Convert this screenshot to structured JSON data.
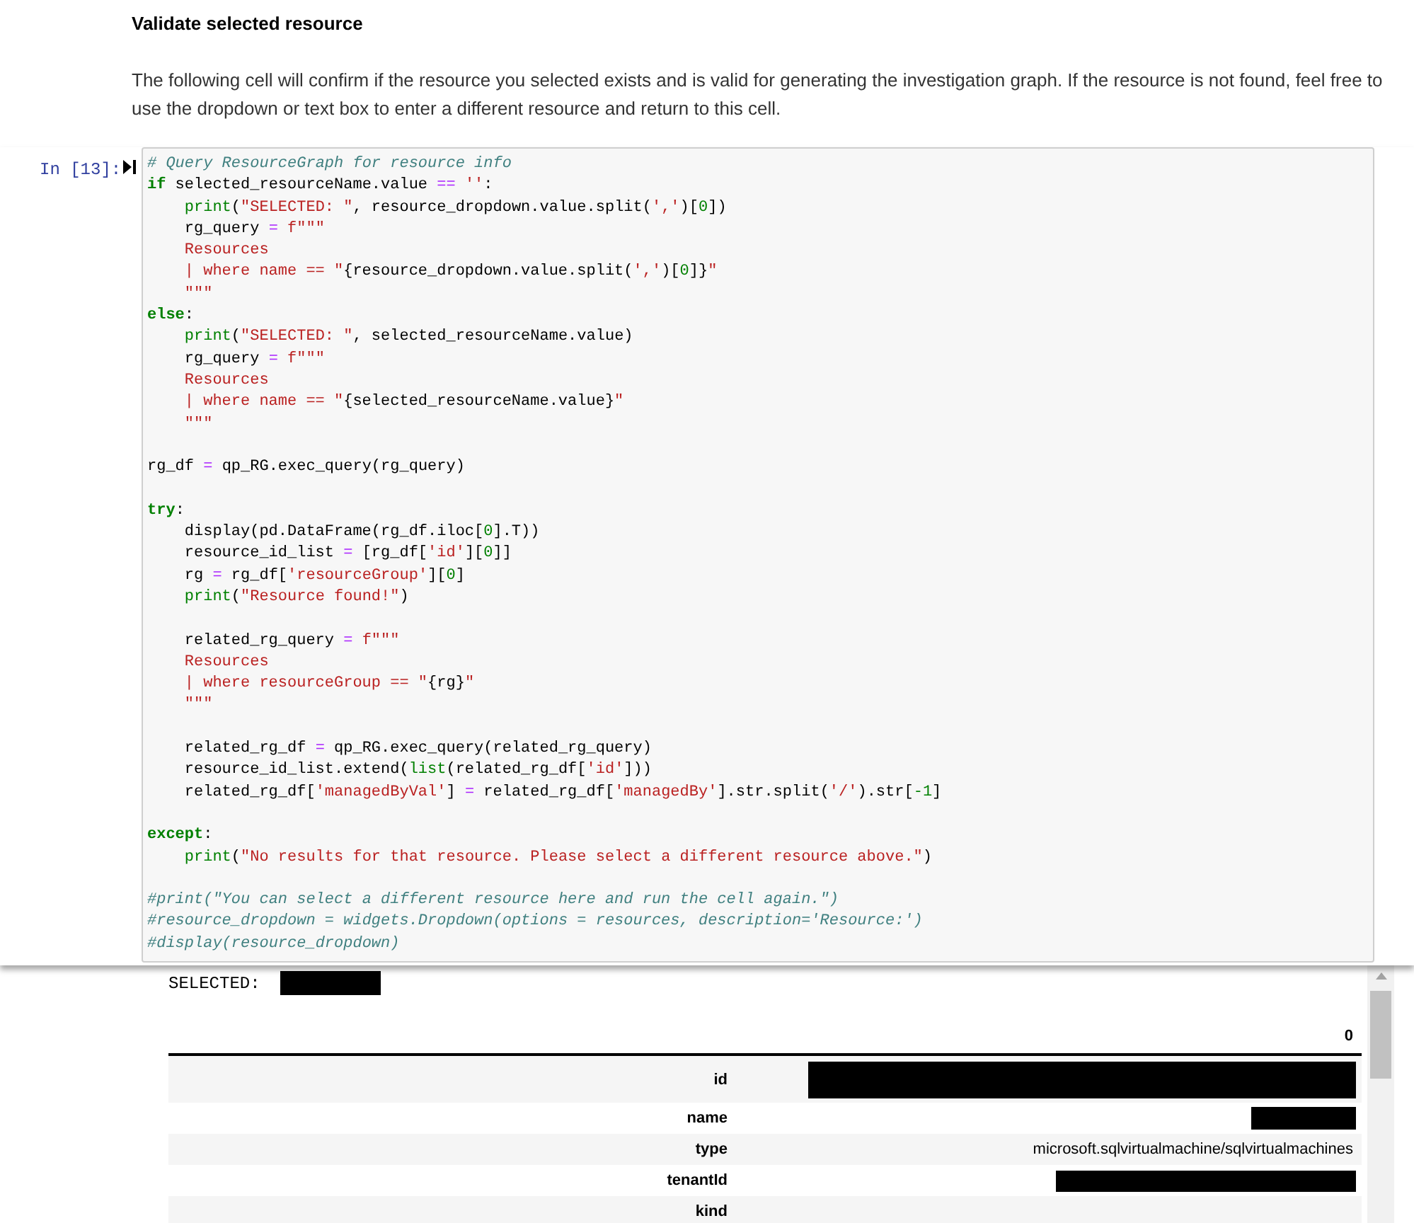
{
  "markdown": {
    "heading": "Validate selected resource",
    "paragraph": "The following cell will confirm if the resource you selected exists and is valid for generating the investigation graph. If the resource is not found, feel free to use the dropdown or text box to enter a different resource and return to this cell."
  },
  "cell": {
    "prompt": "In [13]:",
    "lines": [
      {
        "indented": false,
        "gap_before": false,
        "tokens": [
          {
            "kind": "comment",
            "text": "# Query ResourceGraph for resource info"
          }
        ]
      },
      {
        "indented": false,
        "gap_before": false,
        "tokens": [
          {
            "kind": "keyword",
            "text": "if"
          },
          {
            "kind": "plain",
            "text": " selected_resourceName.value "
          },
          {
            "kind": "operator",
            "text": "=="
          },
          {
            "kind": "string",
            "text": " ''"
          },
          {
            "kind": "plain",
            "text": ":"
          }
        ]
      },
      {
        "indented": true,
        "gap_before": false,
        "tokens": [
          {
            "kind": "builtin",
            "text": "print"
          },
          {
            "kind": "plain",
            "text": "("
          },
          {
            "kind": "string",
            "text": "\"SELECTED: \""
          },
          {
            "kind": "plain",
            "text": ", resource_dropdown.value.split("
          },
          {
            "kind": "string",
            "text": "','"
          },
          {
            "kind": "plain",
            "text": ")["
          },
          {
            "kind": "number",
            "text": "0"
          },
          {
            "kind": "plain",
            "text": "])"
          }
        ]
      },
      {
        "indented": true,
        "gap_before": false,
        "tokens": [
          {
            "kind": "plain",
            "text": "rg_query "
          },
          {
            "kind": "operator",
            "text": "="
          },
          {
            "kind": "string",
            "text": " f\"\"\""
          }
        ]
      },
      {
        "indented": true,
        "gap_before": false,
        "tokens": [
          {
            "kind": "string",
            "text": "Resources"
          }
        ]
      },
      {
        "indented": true,
        "gap_before": false,
        "tokens": [
          {
            "kind": "string",
            "text": "| where name == \""
          },
          {
            "kind": "plain",
            "text": "{resource_dropdown.value.split("
          },
          {
            "kind": "string",
            "text": "','"
          },
          {
            "kind": "plain",
            "text": ")["
          },
          {
            "kind": "number",
            "text": "0"
          },
          {
            "kind": "plain",
            "text": "]}"
          },
          {
            "kind": "string",
            "text": "\""
          }
        ]
      },
      {
        "indented": true,
        "gap_before": false,
        "tokens": [
          {
            "kind": "string",
            "text": "\"\"\""
          }
        ]
      },
      {
        "indented": false,
        "gap_before": false,
        "tokens": [
          {
            "kind": "keyword",
            "text": "else"
          },
          {
            "kind": "plain",
            "text": ":"
          }
        ]
      },
      {
        "indented": true,
        "gap_before": false,
        "tokens": [
          {
            "kind": "builtin",
            "text": "print"
          },
          {
            "kind": "plain",
            "text": "("
          },
          {
            "kind": "string",
            "text": "\"SELECTED: \""
          },
          {
            "kind": "plain",
            "text": ", selected_resourceName.value)"
          }
        ]
      },
      {
        "indented": true,
        "gap_before": false,
        "tokens": [
          {
            "kind": "plain",
            "text": "rg_query "
          },
          {
            "kind": "operator",
            "text": "="
          },
          {
            "kind": "string",
            "text": " f\"\"\""
          }
        ]
      },
      {
        "indented": true,
        "gap_before": false,
        "tokens": [
          {
            "kind": "string",
            "text": "Resources"
          }
        ]
      },
      {
        "indented": true,
        "gap_before": false,
        "tokens": [
          {
            "kind": "string",
            "text": "| where name == \""
          },
          {
            "kind": "plain",
            "text": "{selected_resourceName.value}"
          },
          {
            "kind": "string",
            "text": "\""
          }
        ]
      },
      {
        "indented": true,
        "gap_before": false,
        "tokens": [
          {
            "kind": "string",
            "text": "\"\"\""
          }
        ]
      },
      {
        "indented": false,
        "gap_before": true,
        "tokens": [
          {
            "kind": "plain",
            "text": "rg_df "
          },
          {
            "kind": "operator",
            "text": "="
          },
          {
            "kind": "plain",
            "text": " qp_RG.exec_query(rg_query)"
          }
        ]
      },
      {
        "indented": false,
        "gap_before": true,
        "tokens": [
          {
            "kind": "keyword",
            "text": "try"
          },
          {
            "kind": "plain",
            "text": ":"
          }
        ]
      },
      {
        "indented": true,
        "gap_before": false,
        "tokens": [
          {
            "kind": "plain",
            "text": "display(pd.DataFrame(rg_df.iloc["
          },
          {
            "kind": "number",
            "text": "0"
          },
          {
            "kind": "plain",
            "text": "].T))"
          }
        ]
      },
      {
        "indented": true,
        "gap_before": false,
        "tokens": [
          {
            "kind": "plain",
            "text": "resource_id_list "
          },
          {
            "kind": "operator",
            "text": "="
          },
          {
            "kind": "plain",
            "text": " [rg_df["
          },
          {
            "kind": "string",
            "text": "'id'"
          },
          {
            "kind": "plain",
            "text": "]["
          },
          {
            "kind": "number",
            "text": "0"
          },
          {
            "kind": "plain",
            "text": "]]"
          }
        ]
      },
      {
        "indented": true,
        "gap_before": false,
        "tokens": [
          {
            "kind": "plain",
            "text": "rg "
          },
          {
            "kind": "operator",
            "text": "="
          },
          {
            "kind": "plain",
            "text": " rg_df["
          },
          {
            "kind": "string",
            "text": "'resourceGroup'"
          },
          {
            "kind": "plain",
            "text": "]["
          },
          {
            "kind": "number",
            "text": "0"
          },
          {
            "kind": "plain",
            "text": "]"
          }
        ]
      },
      {
        "indented": true,
        "gap_before": false,
        "tokens": [
          {
            "kind": "builtin",
            "text": "print"
          },
          {
            "kind": "plain",
            "text": "("
          },
          {
            "kind": "string",
            "text": "\"Resource found!\""
          },
          {
            "kind": "plain",
            "text": ")"
          }
        ]
      },
      {
        "indented": true,
        "gap_before": true,
        "tokens": [
          {
            "kind": "plain",
            "text": "related_rg_query "
          },
          {
            "kind": "operator",
            "text": "="
          },
          {
            "kind": "string",
            "text": " f\"\"\""
          }
        ]
      },
      {
        "indented": true,
        "gap_before": false,
        "tokens": [
          {
            "kind": "string",
            "text": "Resources"
          }
        ]
      },
      {
        "indented": true,
        "gap_before": false,
        "tokens": [
          {
            "kind": "string",
            "text": "| where resourceGroup == \""
          },
          {
            "kind": "plain",
            "text": "{rg}"
          },
          {
            "kind": "string",
            "text": "\""
          }
        ]
      },
      {
        "indented": true,
        "gap_before": false,
        "tokens": [
          {
            "kind": "string",
            "text": "\"\"\""
          }
        ]
      },
      {
        "indented": true,
        "gap_before": true,
        "tokens": [
          {
            "kind": "plain",
            "text": "related_rg_df "
          },
          {
            "kind": "operator",
            "text": "="
          },
          {
            "kind": "plain",
            "text": " qp_RG.exec_query(related_rg_query)"
          }
        ]
      },
      {
        "indented": true,
        "gap_before": false,
        "tokens": [
          {
            "kind": "plain",
            "text": "resource_id_list.extend("
          },
          {
            "kind": "builtin",
            "text": "list"
          },
          {
            "kind": "plain",
            "text": "(related_rg_df["
          },
          {
            "kind": "string",
            "text": "'id'"
          },
          {
            "kind": "plain",
            "text": "]))"
          }
        ]
      },
      {
        "indented": true,
        "gap_before": false,
        "tokens": [
          {
            "kind": "plain",
            "text": "related_rg_df["
          },
          {
            "kind": "string",
            "text": "'managedByVal'"
          },
          {
            "kind": "plain",
            "text": "] "
          },
          {
            "kind": "operator",
            "text": "="
          },
          {
            "kind": "plain",
            "text": " related_rg_df["
          },
          {
            "kind": "string",
            "text": "'managedBy'"
          },
          {
            "kind": "plain",
            "text": "].str.split("
          },
          {
            "kind": "string",
            "text": "'/'"
          },
          {
            "kind": "plain",
            "text": ").str["
          },
          {
            "kind": "number",
            "text": "-1"
          },
          {
            "kind": "plain",
            "text": "]"
          }
        ]
      },
      {
        "indented": false,
        "gap_before": true,
        "tokens": [
          {
            "kind": "keyword",
            "text": "except"
          },
          {
            "kind": "plain",
            "text": ":"
          }
        ]
      },
      {
        "indented": true,
        "gap_before": false,
        "tokens": [
          {
            "kind": "builtin",
            "text": "print"
          },
          {
            "kind": "plain",
            "text": "("
          },
          {
            "kind": "string",
            "text": "\"No results for that resource. Please select a different resource above.\""
          },
          {
            "kind": "plain",
            "text": ")"
          }
        ]
      },
      {
        "indented": false,
        "gap_before": true,
        "tokens": [
          {
            "kind": "comment",
            "text": "#print(\"You can select a different resource here and run the cell again.\")"
          }
        ]
      },
      {
        "indented": false,
        "gap_before": false,
        "tokens": [
          {
            "kind": "comment",
            "text": "#resource_dropdown = widgets.Dropdown(options = resources, description='Resource:')"
          }
        ]
      },
      {
        "indented": false,
        "gap_before": false,
        "tokens": [
          {
            "kind": "comment",
            "text": "#display(resource_dropdown)"
          }
        ]
      }
    ]
  },
  "output": {
    "selected": {
      "label": "SELECTED:",
      "redacted": true
    },
    "table": {
      "column_header": "0",
      "rows": [
        {
          "label": "id",
          "kind": "redacted"
        },
        {
          "label": "name",
          "kind": "redacted"
        },
        {
          "label": "type",
          "kind": "text",
          "value": "microsoft.sqlvirtualmachine/sqlvirtualmachines"
        },
        {
          "label": "tenantId",
          "kind": "redacted"
        },
        {
          "label": "kind",
          "kind": "empty"
        }
      ]
    }
  }
}
